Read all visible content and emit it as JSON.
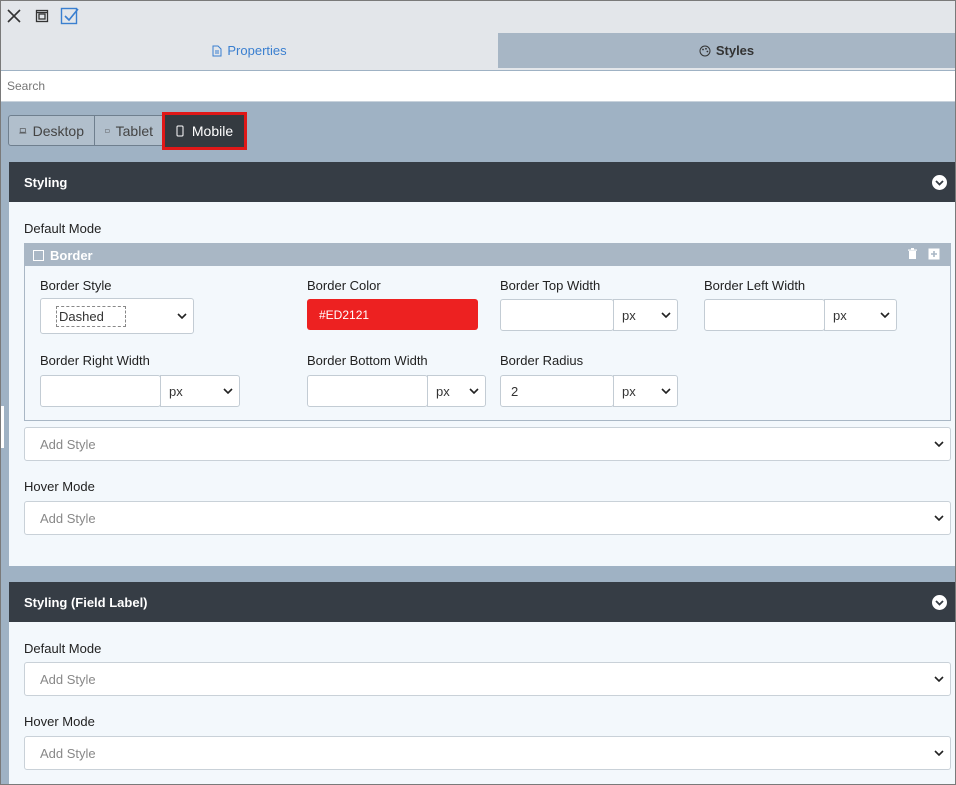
{
  "toolbar": {
    "icons": [
      "close-icon",
      "restore-window-icon",
      "checked-box-icon"
    ]
  },
  "tabs": [
    {
      "label": "Properties",
      "icon": "document-icon",
      "active": false
    },
    {
      "label": "Styles",
      "icon": "palette-icon",
      "active": true
    }
  ],
  "search": {
    "placeholder": "Search"
  },
  "devices": [
    {
      "label": "Desktop",
      "icon": "laptop-icon"
    },
    {
      "label": "Tablet",
      "icon": "tablet-icon"
    },
    {
      "label": "Mobile",
      "icon": "mobile-icon",
      "active": true
    }
  ],
  "panels": [
    {
      "title": "Styling",
      "default_mode_label": "Default Mode",
      "border": {
        "title": "Border",
        "fields": {
          "border_style": {
            "label": "Border Style",
            "value": "Dashed"
          },
          "border_color": {
            "label": "Border Color",
            "value": "#ED2121",
            "color": "#ED2121"
          },
          "border_top_width": {
            "label": "Border Top Width",
            "value": "",
            "unit": "px"
          },
          "border_left_width": {
            "label": "Border Left Width",
            "value": "",
            "unit": "px"
          },
          "border_right_width": {
            "label": "Border Right Width",
            "value": "",
            "unit": "px"
          },
          "border_bottom_width": {
            "label": "Border Bottom Width",
            "value": "",
            "unit": "px"
          },
          "border_radius": {
            "label": "Border Radius",
            "value": "2",
            "unit": "px"
          }
        }
      },
      "add_style_placeholder": "Add Style",
      "hover_mode_label": "Hover Mode",
      "hover_add_style_placeholder": "Add Style"
    },
    {
      "title": "Styling (Field Label)",
      "default_mode_label": "Default Mode",
      "add_style_placeholder": "Add Style",
      "hover_mode_label": "Hover Mode",
      "hover_add_style_placeholder": "Add Style"
    }
  ],
  "colors": {
    "accent_blue": "#3a7fd0",
    "panel_header": "#363d45",
    "highlight_red": "#e01818"
  }
}
